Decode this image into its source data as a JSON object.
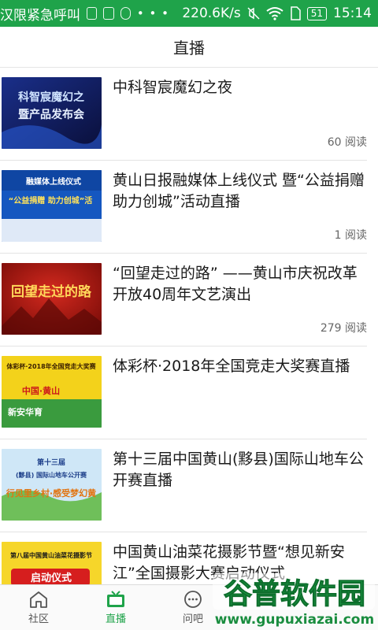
{
  "status_bar": {
    "ticker_text": "汉限紧急呼叫",
    "dots": "• • •",
    "net_speed": "220.6K/s",
    "battery": "51",
    "time": "15:14"
  },
  "header": {
    "title": "直播"
  },
  "items": [
    {
      "title": "中科智宸魔幻之夜",
      "reads": "60 阅读",
      "thumb_text": [
        "科智宸魔幻之",
        "暨产品发布会"
      ]
    },
    {
      "title": "黄山日报融媒体上线仪式 暨“公益捐赠 助力创城”活动直播",
      "reads": "1 阅读",
      "thumb_text": [
        "融媒体上线仪式",
        "“公益捐赠 助力创城”活"
      ]
    },
    {
      "title": "“回望走过的路” ——黄山市庆祝改革开放40周年文艺演出",
      "reads": "279 阅读",
      "thumb_text": [
        "回望走过的路"
      ]
    },
    {
      "title": "体彩杯·2018年全国竞走大奖赛直播",
      "reads": "",
      "thumb_text": [
        "体彩杯·2018年全国竞走大奖赛",
        "中国·黄山",
        "新安华育"
      ]
    },
    {
      "title": "第十三届中国黄山(黟县)国际山地车公开赛直播",
      "reads": "",
      "thumb_text": [
        "第十三届",
        "(黟县) 国际山地车公开赛",
        "行见里乡村·感受梦幻黄"
      ]
    },
    {
      "title": "中国黄山油菜花摄影节暨“想见新安江”全国摄影大赛启动仪式",
      "reads": "",
      "thumb_text": [
        "第八届中国黄山油菜花摄影节",
        "启动仪式"
      ]
    }
  ],
  "tabs": [
    {
      "label": "社区",
      "icon": "home-icon"
    },
    {
      "label": "直播",
      "icon": "tv-icon",
      "active": true
    },
    {
      "label": "问吧",
      "icon": "chat-icon"
    }
  ],
  "watermark": {
    "text": "谷普软件园",
    "url": "www.gupuxiazai.com"
  },
  "colors": {
    "accent": "#1fa34a",
    "text": "#1a1a1a",
    "muted": "#666666"
  }
}
